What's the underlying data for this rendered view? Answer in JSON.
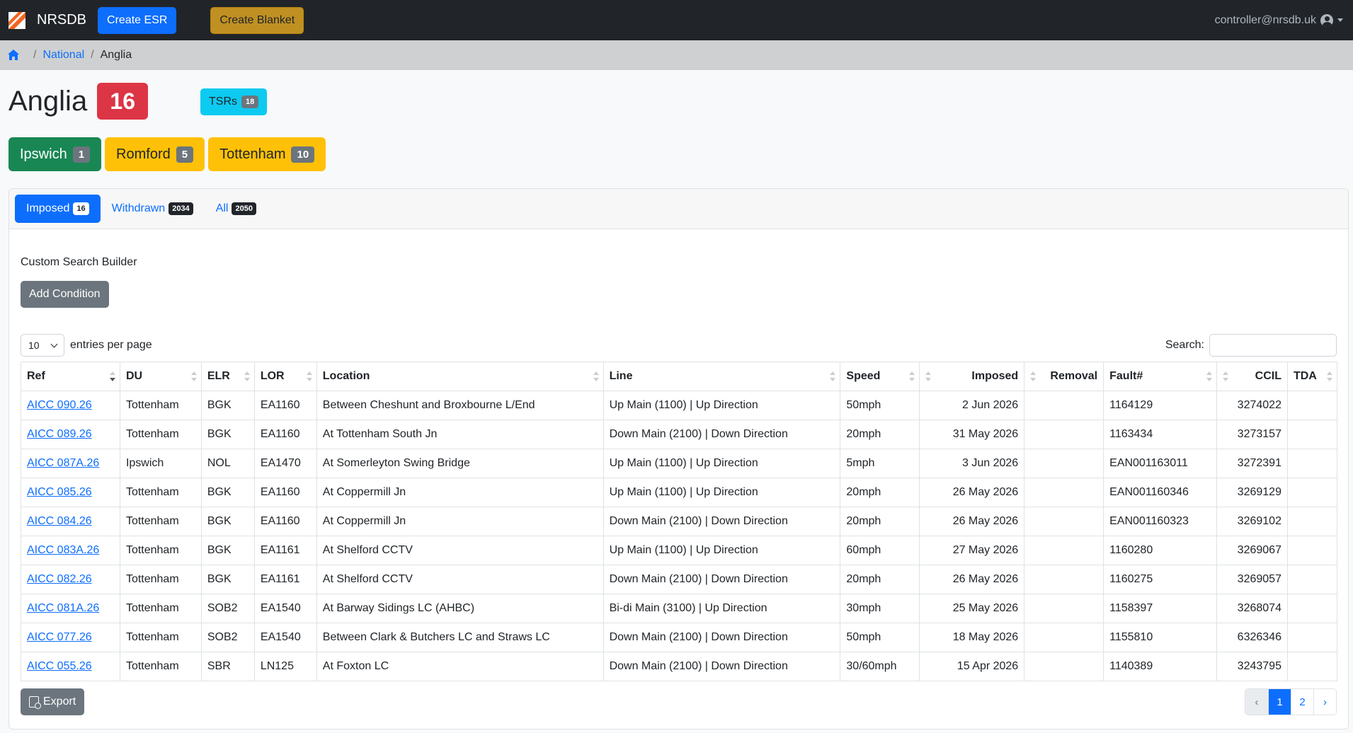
{
  "navbar": {
    "brand": "NRSDB",
    "create_esr": "Create ESR",
    "create_blanket": "Create Blanket",
    "user": "controller@nrsdb.uk"
  },
  "breadcrumb": {
    "national": "National",
    "separator": "/",
    "current": "Anglia"
  },
  "header": {
    "title": "Anglia",
    "count": "16",
    "tsrs_label": "TSRs",
    "tsrs_count": "18"
  },
  "delivery_units": [
    {
      "name": "Ipswich",
      "count": "1",
      "color": "#198754"
    },
    {
      "name": "Romford",
      "count": "5",
      "color": "#ffc107"
    },
    {
      "name": "Tottenham",
      "count": "10",
      "color": "#ffc107"
    }
  ],
  "tabs": [
    {
      "label": "Imposed",
      "count": "16"
    },
    {
      "label": "Withdrawn",
      "count": "2034"
    },
    {
      "label": "All",
      "count": "2050"
    }
  ],
  "search_builder": {
    "label": "Custom Search Builder",
    "add_condition": "Add Condition"
  },
  "table_controls": {
    "entries_value": "10",
    "entries_label": "entries per page",
    "search_label": "Search:"
  },
  "columns": [
    "Ref",
    "DU",
    "ELR",
    "LOR",
    "Location",
    "Line",
    "Speed",
    "Imposed",
    "Removal",
    "Fault#",
    "CCIL",
    "TDA"
  ],
  "rows": [
    [
      "AICC 090.26",
      "Tottenham",
      "BGK",
      "EA1160",
      "Between Cheshunt and Broxbourne L/End",
      "Up Main (1100) | Up Direction",
      "50mph",
      "2 Jun 2026",
      "",
      "1164129",
      "3274022",
      ""
    ],
    [
      "AICC 089.26",
      "Tottenham",
      "BGK",
      "EA1160",
      "At Tottenham South Jn",
      "Down Main (2100) | Down Direction",
      "20mph",
      "31 May 2026",
      "",
      "1163434",
      "3273157",
      ""
    ],
    [
      "AICC 087A.26",
      "Ipswich",
      "NOL",
      "EA1470",
      "At Somerleyton Swing Bridge",
      "Up Main (1100) | Up Direction",
      "5mph",
      "3 Jun 2026",
      "",
      "EAN001163011",
      "3272391",
      ""
    ],
    [
      "AICC 085.26",
      "Tottenham",
      "BGK",
      "EA1160",
      "At Coppermill Jn",
      "Up Main (1100) | Up Direction",
      "20mph",
      "26 May 2026",
      "",
      "EAN001160346",
      "3269129",
      ""
    ],
    [
      "AICC 084.26",
      "Tottenham",
      "BGK",
      "EA1160",
      "At Coppermill Jn",
      "Down Main (2100) | Down Direction",
      "20mph",
      "26 May 2026",
      "",
      "EAN001160323",
      "3269102",
      ""
    ],
    [
      "AICC 083A.26",
      "Tottenham",
      "BGK",
      "EA1161",
      "At Shelford CCTV",
      "Up Main (1100) | Up Direction",
      "60mph",
      "27 May 2026",
      "",
      "1160280",
      "3269067",
      ""
    ],
    [
      "AICC 082.26",
      "Tottenham",
      "BGK",
      "EA1161",
      "At Shelford CCTV",
      "Down Main (2100) | Down Direction",
      "20mph",
      "26 May 2026",
      "",
      "1160275",
      "3269057",
      ""
    ],
    [
      "AICC 081A.26",
      "Tottenham",
      "SOB2",
      "EA1540",
      "At Barway Sidings LC (AHBC)",
      "Bi-di Main (3100) | Up Direction",
      "30mph",
      "25 May 2026",
      "",
      "1158397",
      "3268074",
      ""
    ],
    [
      "AICC 077.26",
      "Tottenham",
      "SOB2",
      "EA1540",
      "Between Clark & Butchers LC and Straws LC",
      "Down Main (2100) | Down Direction",
      "50mph",
      "18 May 2026",
      "",
      "1155810",
      "6326346",
      ""
    ],
    [
      "AICC 055.26",
      "Tottenham",
      "SBR",
      "LN125",
      "At Foxton LC",
      "Down Main (2100) | Down Direction",
      "30/60mph",
      "15 Apr 2026",
      "",
      "1140389",
      "3243795",
      ""
    ]
  ],
  "footer": {
    "export": "Export",
    "pagination": [
      "‹",
      "1",
      "2",
      "›"
    ]
  }
}
